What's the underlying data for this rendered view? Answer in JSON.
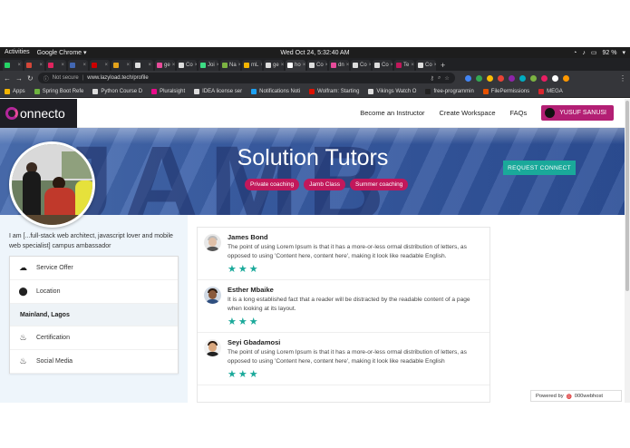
{
  "system_bar": {
    "activities": "Activities",
    "app": "Google Chrome ▾",
    "clock": "Wed Oct 24,  5:32:40 AM",
    "battery": "92 %"
  },
  "browser": {
    "tabs": [
      {
        "label": "",
        "color": "#25d366"
      },
      {
        "label": "",
        "color": "#d44638"
      },
      {
        "label": "",
        "color": "#e0245e"
      },
      {
        "label": "",
        "color": "#4267b2"
      },
      {
        "label": "",
        "color": "#cc0000"
      },
      {
        "label": "",
        "color": "#e3a21a"
      },
      {
        "label": "",
        "color": "#dddddd"
      },
      {
        "label": "ge",
        "color": "#e84b9a"
      },
      {
        "label": "Co",
        "color": "#dddddd"
      },
      {
        "label": "Joi",
        "color": "#3ddc84"
      },
      {
        "label": "Na",
        "color": "#7cb342"
      },
      {
        "label": "mL",
        "color": "#f4b400"
      },
      {
        "label": "ge",
        "color": "#dddddd"
      },
      {
        "label": "ho",
        "color": "#ffffff",
        "active": true
      },
      {
        "label": "Co",
        "color": "#dddddd"
      },
      {
        "label": "dn",
        "color": "#e84b9a"
      },
      {
        "label": "Co",
        "color": "#dddddd"
      },
      {
        "label": "Co",
        "color": "#dddddd"
      },
      {
        "label": "Te",
        "color": "#c2185b"
      },
      {
        "label": "Co",
        "color": "#dddddd"
      }
    ],
    "not_secure": "Not secure",
    "url": "www.lazyload.tech/profile",
    "bookmarks": [
      {
        "label": "Apps",
        "color": "#f4b400"
      },
      {
        "label": "Spring Boot Refe",
        "color": "#6db33f"
      },
      {
        "label": "Python Course D",
        "color": "#dddddd"
      },
      {
        "label": "Pluralsight",
        "color": "#e80a89"
      },
      {
        "label": "IDEA license ser",
        "color": "#dddddd"
      },
      {
        "label": "Notifications Noti",
        "color": "#1da1f2"
      },
      {
        "label": "Wolfram: Starting",
        "color": "#dd1100"
      },
      {
        "label": "Vikings Watch O",
        "color": "#dddddd"
      },
      {
        "label": "free-programmin",
        "color": "#222222"
      },
      {
        "label": "FilePermissions",
        "color": "#e65100"
      },
      {
        "label": "MEGA",
        "color": "#d9272e"
      }
    ]
  },
  "header": {
    "logo_text": "onnecto",
    "nav": [
      "Become an Instructor",
      "Create Workspace",
      "FAQs"
    ],
    "user_name": "YUSUF SANUSI"
  },
  "banner": {
    "title": "Solution Tutors",
    "tags": [
      "Private coaching",
      "Jamb Class",
      "Summer coaching"
    ],
    "request_button": "REQUEST CONNECT"
  },
  "profile": {
    "bio": "I am [...full-stack web architect, javascript lover and mobile web specialist] campus ambassador",
    "sidebar_items": [
      {
        "label": "Service Offer",
        "icon": "cloud-icon"
      },
      {
        "label": "Location",
        "icon": "location-pin-icon"
      },
      {
        "label": "Mainland, Lagos",
        "icon": ""
      },
      {
        "label": "Certification",
        "icon": "flame-icon"
      },
      {
        "label": "Social Media",
        "icon": "flame-icon"
      }
    ]
  },
  "reviews": [
    {
      "name": "James Bond",
      "text": "The point of using Lorem Ipsum is that it has a more-or-less ormal distribution of letters, as opposed to using 'Content here, content here', making it look like readable English.",
      "rating": 3
    },
    {
      "name": "Esther Mbaike",
      "text": "It is a long established fact that a reader will be distracted by the readable content of a page when looking at its layout.",
      "rating": 3
    },
    {
      "name": "Seyi Gbadamosi",
      "text": "The point of using Lorem Ipsum is that it has a more-or-less ormal distribution of letters, as opposed to using 'Content here, content here', making it look like readable English",
      "rating": 3
    }
  ],
  "footer_badge": {
    "prefix": "Powered by",
    "brand": "000webhost"
  },
  "colors": {
    "accent_magenta": "#b31f74",
    "tag_pink": "#c2185b",
    "teal": "#1aa99a",
    "banner_blue": "#3a5ea6"
  }
}
